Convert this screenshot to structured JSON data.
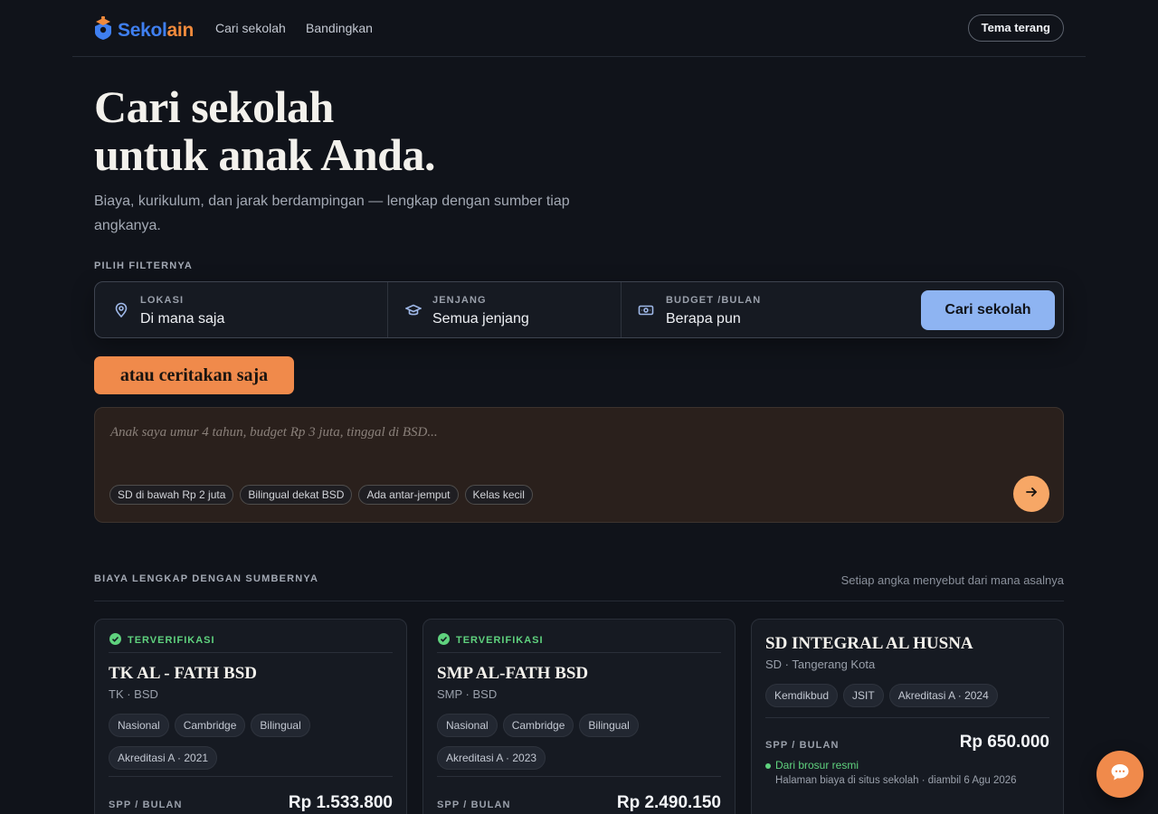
{
  "header": {
    "logo_part1": "Sekol",
    "logo_part2": "ain",
    "nav": [
      "Cari sekolah",
      "Bandingkan"
    ],
    "theme_toggle": "Tema terang"
  },
  "hero": {
    "title_line1": "Cari sekolah",
    "title_line2": "untuk anak Anda.",
    "subtitle": "Biaya, kurikulum, dan jarak berdampingan — lengkap dengan sumber tiap angkanya."
  },
  "filter": {
    "heading": "PILIH FILTERNYA",
    "location": {
      "label": "LOKASI",
      "value": "Di mana saja"
    },
    "level": {
      "label": "JENJANG",
      "value": "Semua jenjang"
    },
    "budget": {
      "label": "BUDGET /BULAN",
      "value": "Berapa pun"
    },
    "search_button": "Cari sekolah"
  },
  "tell": {
    "pill": "atau ceritakan saja",
    "placeholder": "Anak saya umur 4 tahun, budget Rp 3 juta, tinggal di BSD...",
    "chips": [
      "SD di bawah Rp 2 juta",
      "Bilingual dekat BSD",
      "Ada antar-jemput",
      "Kelas kecil"
    ]
  },
  "section": {
    "title": "BIAYA LENGKAP DENGAN SUMBERNYA",
    "note": "Setiap angka menyebut dari mana asalnya"
  },
  "cards": [
    {
      "badge": "TERVERIFIKASI",
      "name": "TK AL - FATH BSD",
      "meta": "TK · BSD",
      "tags": [
        "Nasional",
        "Cambridge",
        "Bilingual",
        "Akreditasi A · 2021"
      ],
      "price_label": "SPP / BULAN",
      "price": "Rp 1.533.800"
    },
    {
      "badge": "TERVERIFIKASI",
      "name": "SMP AL-FATH BSD",
      "meta": "SMP · BSD",
      "tags": [
        "Nasional",
        "Cambridge",
        "Bilingual",
        "Akreditasi A · 2023"
      ],
      "price_label": "SPP / BULAN",
      "price": "Rp 2.490.150"
    },
    {
      "name": "SD INTEGRAL AL HUSNA",
      "meta": "SD · Tangerang Kota",
      "tags": [
        "Kemdikbud",
        "JSIT",
        "Akreditasi A · 2024"
      ],
      "price_label": "SPP / BULAN",
      "price": "Rp 650.000",
      "source": "Dari brosur resmi",
      "source_note": "Halaman biaya di situs sekolah · diambil 6 Agu 2026"
    }
  ],
  "colors": {
    "background": "#10131a",
    "brand_blue": "#3f7ff0",
    "brand_orange": "#f08a3c",
    "primary_button": "#8eb4f2",
    "verified_green": "#5fd27e"
  }
}
